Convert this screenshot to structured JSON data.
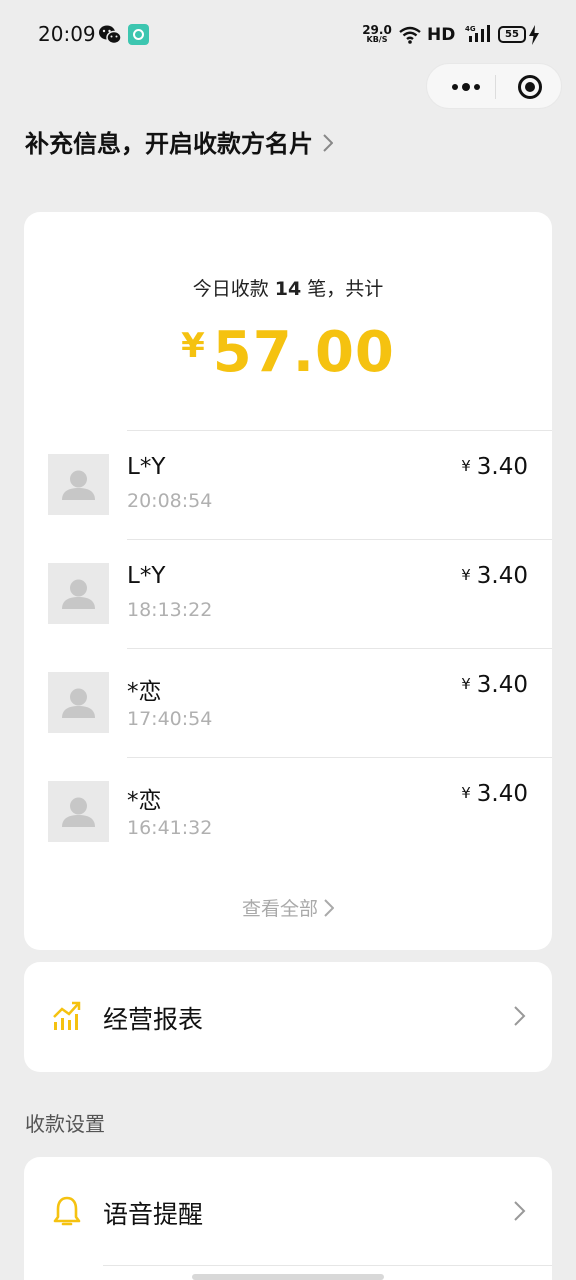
{
  "status_bar": {
    "time": "20:09",
    "net_speed_value": "29.0",
    "net_speed_unit": "KB/S",
    "hd_label": "HD",
    "battery_level": "55",
    "icons": [
      "wechat-icon",
      "app-badge-icon",
      "wifi-icon",
      "signal-4g-icon",
      "battery-icon",
      "charging-bolt-icon"
    ]
  },
  "capsule": {
    "icons": [
      "more-dots-icon",
      "target-close-icon"
    ]
  },
  "header": {
    "link_text": "补充信息，开启收款方名片"
  },
  "summary": {
    "prefix": "今日收款",
    "count": "14",
    "suffix": "笔，共计",
    "currency": "¥",
    "total": "57.00",
    "accent_color": "#f5c210"
  },
  "transactions": [
    {
      "name": "L*Y",
      "time": "20:08:54",
      "currency": "¥",
      "amount": "3.40"
    },
    {
      "name": "L*Y",
      "time": "18:13:22",
      "currency": "¥",
      "amount": "3.40"
    },
    {
      "name": "*恋",
      "time": "17:40:54",
      "currency": "¥",
      "amount": "3.40"
    },
    {
      "name": "*恋",
      "time": "16:41:32",
      "currency": "¥",
      "amount": "3.40"
    }
  ],
  "view_all_label": "查看全部",
  "report": {
    "label": "经营报表",
    "icon": "chart-trend-icon"
  },
  "settings": {
    "section_title": "收款设置",
    "items": [
      {
        "label": "语音提醒",
        "icon": "bell-icon"
      }
    ]
  }
}
